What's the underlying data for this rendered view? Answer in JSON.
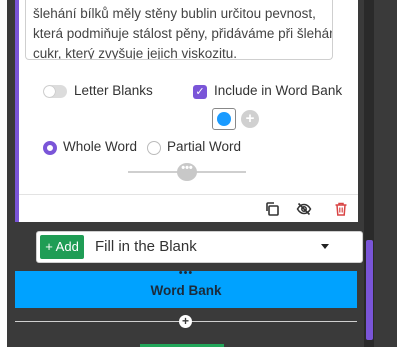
{
  "editor": {
    "text_lines": [
      "šlehání bílků měly stěny bublin určitou pevnost,",
      "která podmiňuje stálost pěny, přidáváme při šlehání",
      "cukr, který zvyšuje jejich viskozitu."
    ],
    "letter_blanks_label": "Letter Blanks",
    "letter_blanks_on": false,
    "include_word_bank_label": "Include in Word Bank",
    "include_word_bank_checked": true,
    "blank_color": "#1a9bff",
    "match_mode": {
      "whole_word_label": "Whole Word",
      "partial_word_label": "Partial Word",
      "selected": "Whole Word"
    },
    "slider_handle_glyph": "•••",
    "toolbar_icons": [
      "copy-icon",
      "eye-off-icon",
      "trash-icon"
    ]
  },
  "add_blank": {
    "button_label": "+ Add",
    "selected_type": "Fill in the Blank"
  },
  "word_bank": {
    "drag_handle_glyph": "•••",
    "label": "Word Bank"
  },
  "colors": {
    "accent_purple": "#7a55d8",
    "word_bank_blue": "#00a2ff",
    "add_green": "#1f9d55",
    "delete_red": "#d94444"
  }
}
